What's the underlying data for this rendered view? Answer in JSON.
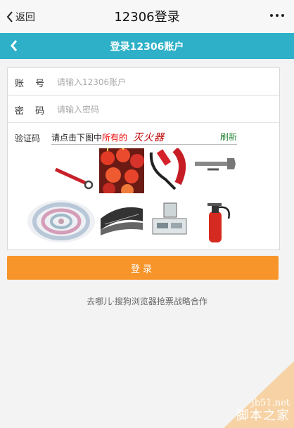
{
  "header": {
    "back_label": "返回",
    "title": "12306登录"
  },
  "subheader": {
    "title": "登录12306账户"
  },
  "form": {
    "account": {
      "label": "账 号",
      "placeholder": "请输入12306账户"
    },
    "password": {
      "label": "密 码",
      "placeholder": "请输入密码"
    },
    "captcha": {
      "label": "验证码",
      "prompt_prefix": "请点击下图中",
      "prompt_highlight": "所有的",
      "prompt_word": "灭火器",
      "refresh_label": "刷新",
      "images": [
        "tool-icon",
        "lanterns-icon",
        "wrench-icon",
        "wrench-icon",
        "swirl-icon",
        "stapler-icon",
        "scale-icon",
        "fire-extinguisher-icon"
      ]
    }
  },
  "login_label": "登录",
  "partner_text": "去哪儿·搜狗浏览器抢票战略合作",
  "watermark": {
    "url": "jb51.net",
    "name": "脚本之家"
  },
  "colors": {
    "accent": "#2db0c8",
    "button": "#f7952b"
  }
}
